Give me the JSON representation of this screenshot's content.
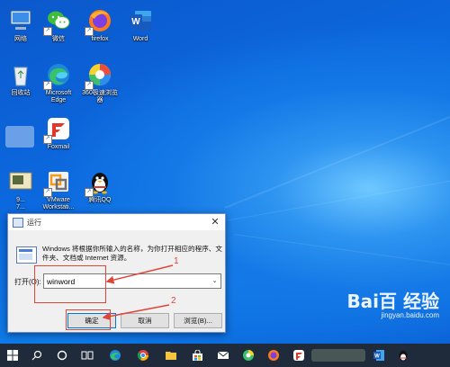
{
  "desktop": {
    "icons": [
      {
        "label": "网络",
        "name": "network"
      },
      {
        "label": "微信",
        "name": "wechat"
      },
      {
        "label": "firefox",
        "name": "firefox"
      },
      {
        "label": "Word",
        "name": "word"
      },
      {
        "label": "回收站",
        "name": "recycle-bin"
      },
      {
        "label": "Microsoft Edge",
        "name": "edge"
      },
      {
        "label": "360极速浏览器",
        "name": "360-browser"
      },
      {
        "label": "Foxmail",
        "name": "foxmail"
      },
      {
        "label": "9...\n7...",
        "name": "unknown-app"
      },
      {
        "label": "VMware Workstati...",
        "name": "vmware"
      },
      {
        "label": "腾讯QQ",
        "name": "qq"
      }
    ]
  },
  "run_dialog": {
    "title": "运行",
    "close_glyph": "✕",
    "description": "Windows 将根据你所输入的名称，为你打开相应的程序、文件夹、文档或 Internet 资源。",
    "open_label": "打开(O):",
    "open_value": "winword",
    "ok_label": "确定",
    "cancel_label": "取消",
    "browse_label": "浏览(B)..."
  },
  "annotations": {
    "marker1": "1",
    "marker2": "2"
  },
  "watermark": {
    "logo": "Bai百 经验",
    "sub": "jingyan.baidu.com"
  },
  "taskbar": {
    "items": [
      "start",
      "search",
      "task-view",
      "edge",
      "chrome",
      "file-explorer",
      "store",
      "mail",
      "360-browser",
      "firefox",
      "foxmail",
      "word",
      "qq"
    ]
  },
  "colors": {
    "accent": "#0078d7",
    "annotation_red": "#e0453a",
    "taskbar": "#1f2b3a"
  }
}
